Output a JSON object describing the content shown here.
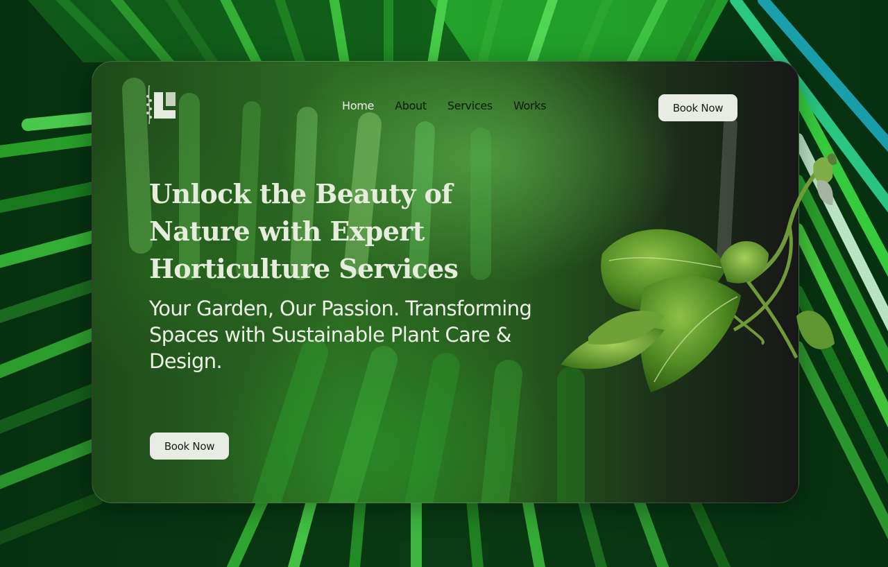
{
  "nav": {
    "items": [
      {
        "label": "Home"
      },
      {
        "label": "About"
      },
      {
        "label": "Services"
      },
      {
        "label": "Works"
      }
    ],
    "cta_label": "Book Now"
  },
  "hero": {
    "headline": "Unlock the Beauty of Nature with Expert Horticulture Services",
    "subheadline": "Your Garden, Our Passion. Transforming Spaces with Sustainable Plant Care & Design.",
    "cta_label": "Book Now"
  },
  "icons": {
    "logo": "leaf-logo-icon",
    "plant": "pothos-plant-image",
    "background": "palm-leaves-background"
  },
  "colors": {
    "leaf_green": "#2fa82a",
    "card_dark": "#171717",
    "button_bg": "#e9ece4",
    "headline": "#e6eddc"
  }
}
